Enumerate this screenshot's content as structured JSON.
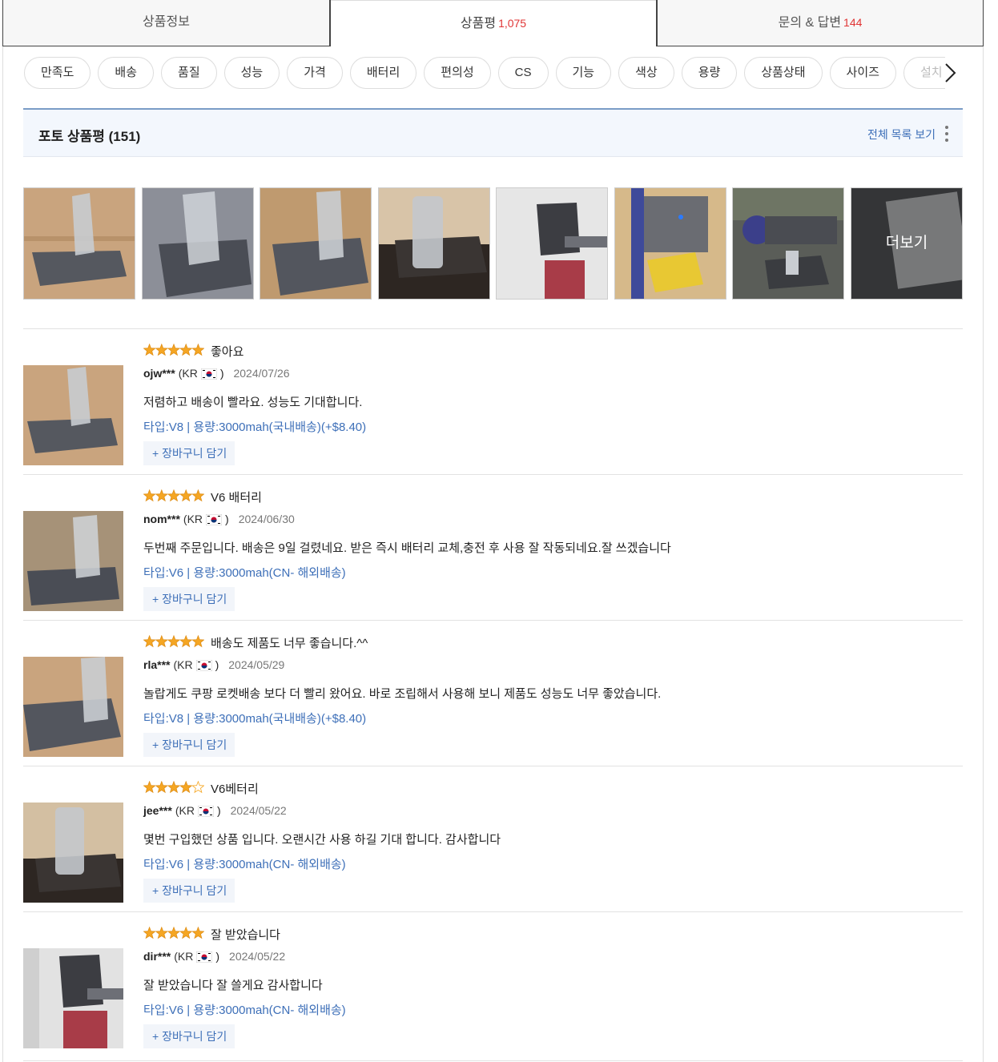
{
  "tabs": [
    {
      "label": "상품정보",
      "count": ""
    },
    {
      "label": "상품평",
      "count": "1,075"
    },
    {
      "label": "문의 & 답변",
      "count": "144"
    }
  ],
  "filter_chips": [
    "만족도",
    "배송",
    "품질",
    "성능",
    "가격",
    "배터리",
    "편의성",
    "CS",
    "기능",
    "색상",
    "용량",
    "상품상태",
    "사이즈",
    "설치"
  ],
  "photo_reviews": {
    "title": "포토 상품평 (151)",
    "view_all": "전체 목록 보기",
    "more_label": "더보기"
  },
  "reviews": [
    {
      "rating": 5,
      "title": "좋아요",
      "user": "ojw***",
      "country": "(KR",
      "country_close": ")",
      "date": "2024/07/26",
      "text": "저렴하고 배송이 빨라요. 성능도 기대합니다.",
      "option": "타입:V8 | 용량:3000mah(국내배송)(+$8.40)",
      "cart": "+ 장바구니 담기"
    },
    {
      "rating": 5,
      "title": "V6 배터리",
      "user": "nom***",
      "country": "(KR",
      "country_close": ")",
      "date": "2024/06/30",
      "text": "두번째 주문입니다. 배송은 9일 걸렸네요. 받은 즉시 배터리 교체,충전 후 사용 잘 작동되네요.잘 쓰겠습니다",
      "option": "타입:V6 | 용량:3000mah(CN- 해외배송)",
      "cart": "+ 장바구니 담기"
    },
    {
      "rating": 5,
      "title": "배송도 제품도 너무 좋습니다.^^",
      "user": "rla***",
      "country": "(KR",
      "country_close": ")",
      "date": "2024/05/29",
      "text": "놀랍게도 쿠팡 로켓배송 보다 더 빨리 왔어요. 바로 조립해서 사용해 보니 제품도 성능도 너무 좋았습니다.",
      "option": "타입:V8 | 용량:3000mah(국내배송)(+$8.40)",
      "cart": "+ 장바구니 담기"
    },
    {
      "rating": 4,
      "title": "V6베터리",
      "user": "jee***",
      "country": "(KR",
      "country_close": ")",
      "date": "2024/05/22",
      "text": "몇번 구입했던 상품 입니다. 오랜시간 사용 하길 기대 합니다. 감사합니다",
      "option": "타입:V6 | 용량:3000mah(CN- 해외배송)",
      "cart": "+ 장바구니 담기"
    },
    {
      "rating": 5,
      "title": "잘 받았습니다",
      "user": "dir***",
      "country": "(KR",
      "country_close": ")",
      "date": "2024/05/22",
      "text": "잘 받았습니다 잘 쓸게요 감사합니다",
      "option": "타입:V6 | 용량:3000mah(CN- 해외배송)",
      "cart": "+ 장바구니 담기"
    }
  ],
  "colors": {
    "accent_red": "#e03535",
    "link_blue": "#3d6fb8",
    "star": "#f5a623"
  }
}
